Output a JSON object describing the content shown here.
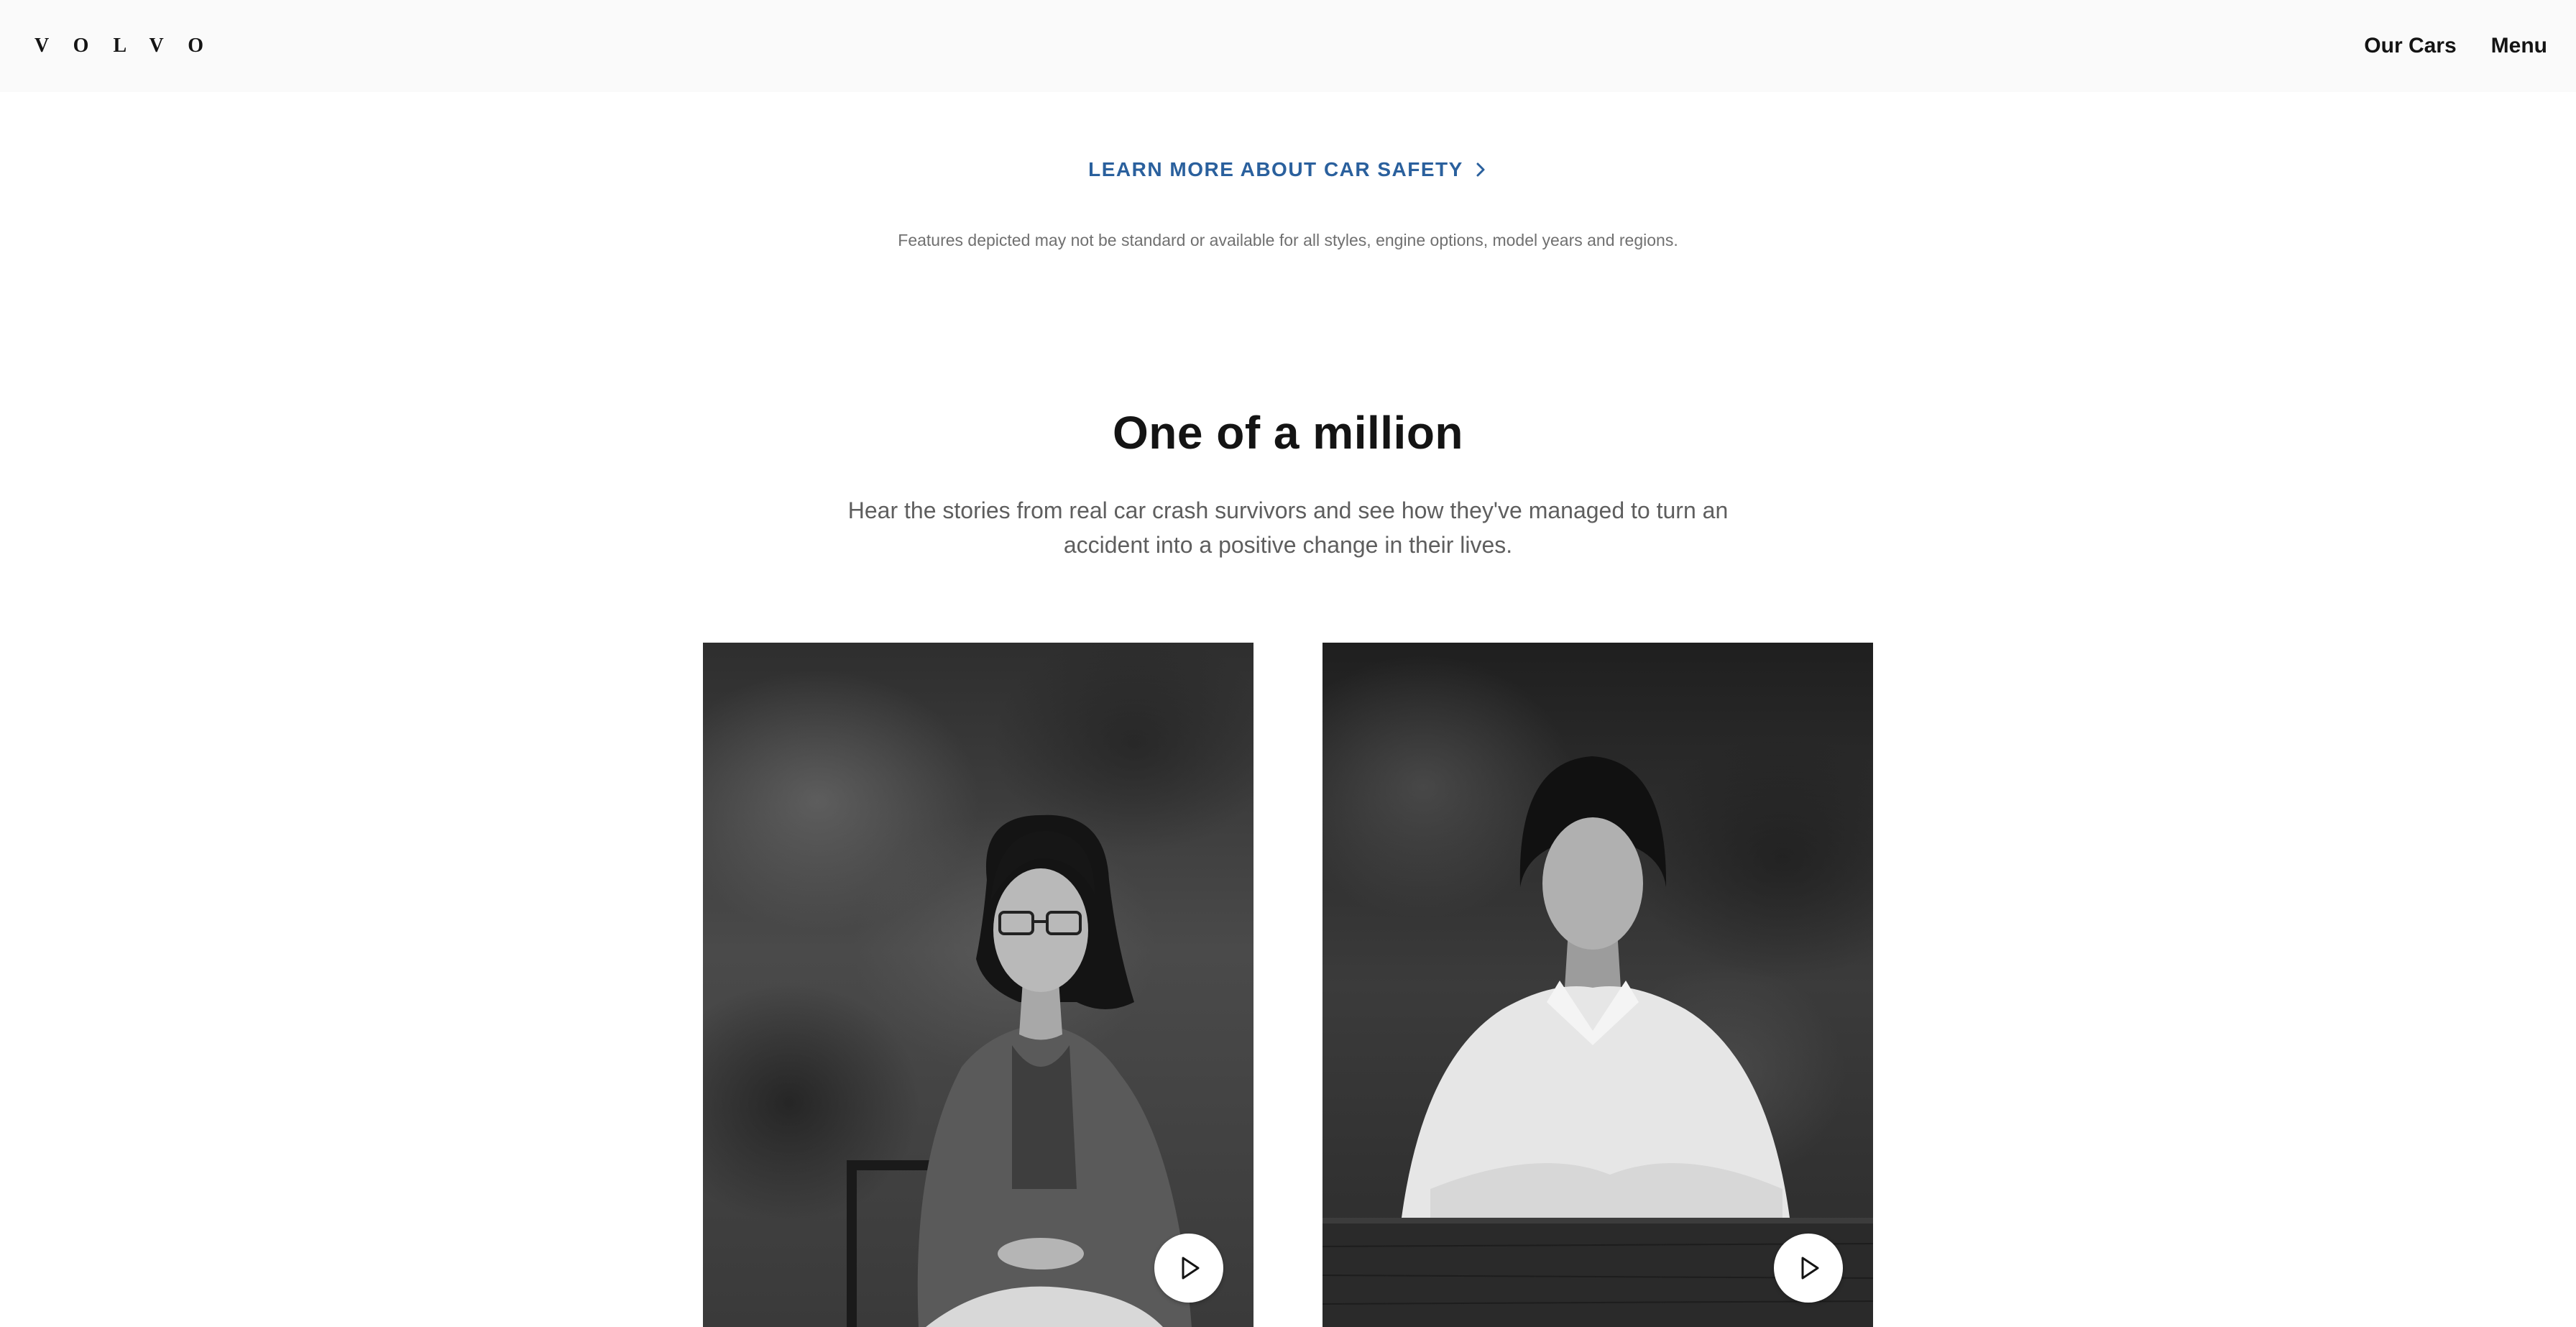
{
  "header": {
    "logo_text": "VOLVO",
    "nav": {
      "our_cars": "Our Cars",
      "menu": "Menu"
    }
  },
  "safety": {
    "link_label": "LEARN MORE ABOUT CAR SAFETY",
    "link_icon": "chevron-right-icon",
    "disclaimer": "Features depicted may not be standard or available for all styles, engine options, model years and regions."
  },
  "stories": {
    "title": "One of a million",
    "subtitle": "Hear the stories from real car crash survivors and see how they've managed to turn an accident into a positive change in their lives.",
    "cards": [
      {
        "image": "black-and-white portrait of a woman with glasses seated in a chair",
        "icon": "play-icon"
      },
      {
        "image": "black-and-white portrait of a woman in a white shirt seated at a table",
        "icon": "play-icon"
      }
    ]
  },
  "colors": {
    "header_bg": "#fafafa",
    "link_blue": "#2a609d",
    "heading": "#141414",
    "body_text": "#5e5e5e",
    "disclaimer_text": "#707070"
  }
}
